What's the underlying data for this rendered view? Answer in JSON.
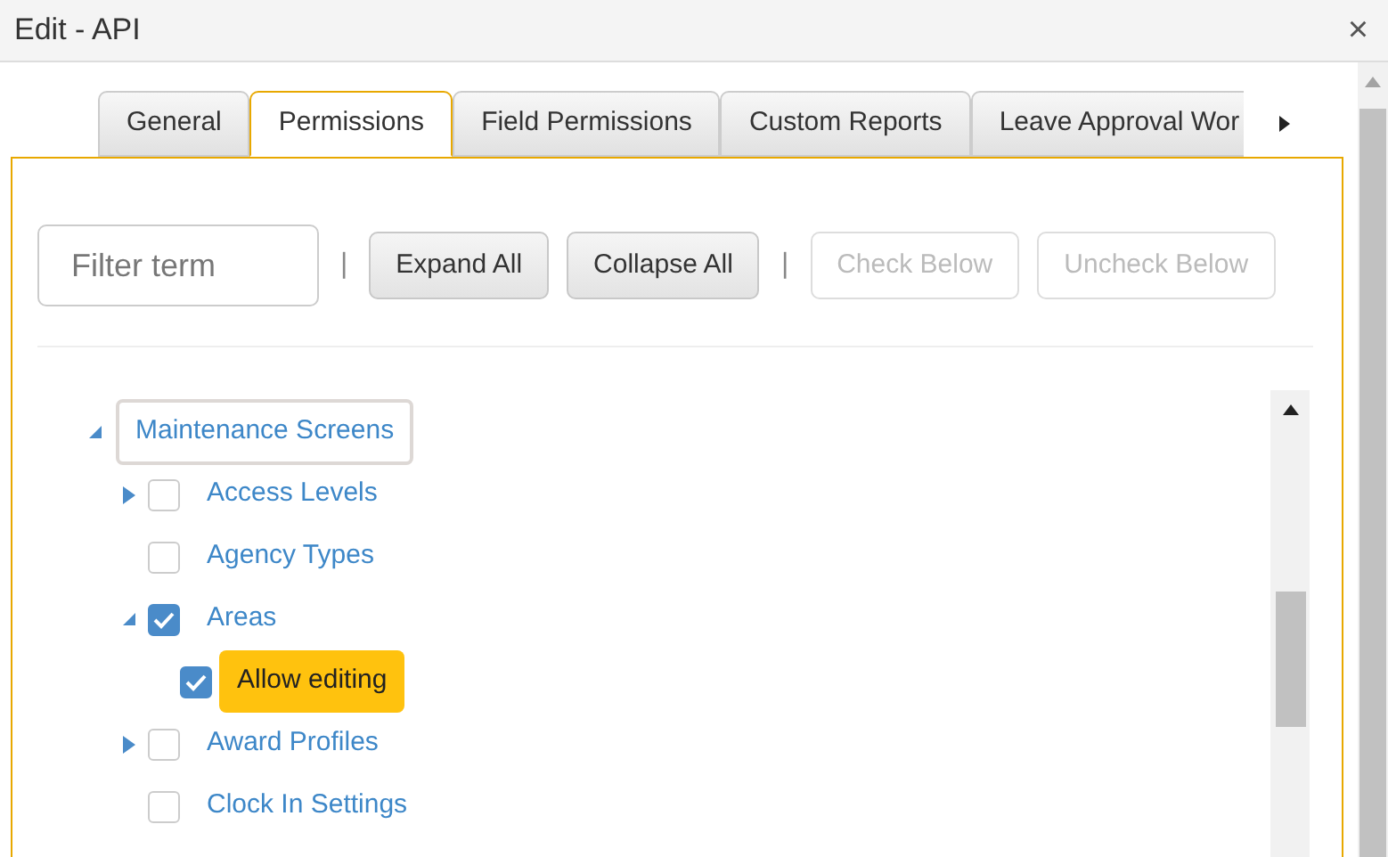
{
  "window": {
    "title": "Edit - API",
    "close": "×"
  },
  "tabs": [
    {
      "label": "General",
      "selected": false
    },
    {
      "label": "Permissions",
      "selected": true
    },
    {
      "label": "Field Permissions",
      "selected": false
    },
    {
      "label": "Custom Reports",
      "selected": false
    },
    {
      "label": "Leave Approval Wor",
      "selected": false
    }
  ],
  "toolbar": {
    "filter": {
      "placeholder": "Filter term"
    },
    "separator": "|",
    "buttons": [
      {
        "label": "Expand All",
        "disabled": false
      },
      {
        "label": "Collapse All",
        "disabled": false
      },
      {
        "label": "Check Below",
        "disabled": true
      },
      {
        "label": "Uncheck Below",
        "disabled": true
      }
    ]
  },
  "tree": [
    {
      "kind": "group",
      "label": "Maintenance Screens",
      "expanded": true,
      "focused": true,
      "children": [
        {
          "kind": "item",
          "label": "Access Levels",
          "expanded": false,
          "checked": false,
          "selected": false
        },
        {
          "kind": "item",
          "label": "Agency Types",
          "checked": false,
          "selected": false
        },
        {
          "kind": "item",
          "label": "Areas",
          "expanded": true,
          "checked": true,
          "selected": false,
          "children": [
            {
              "kind": "item",
              "label": "Allow editing",
              "checked": true,
              "selected": true
            }
          ]
        },
        {
          "kind": "item",
          "label": "Award Profiles",
          "expanded": false,
          "checked": false,
          "selected": false
        },
        {
          "kind": "item",
          "label": "Clock In Settings",
          "checked": false,
          "selected": false
        }
      ]
    }
  ]
}
